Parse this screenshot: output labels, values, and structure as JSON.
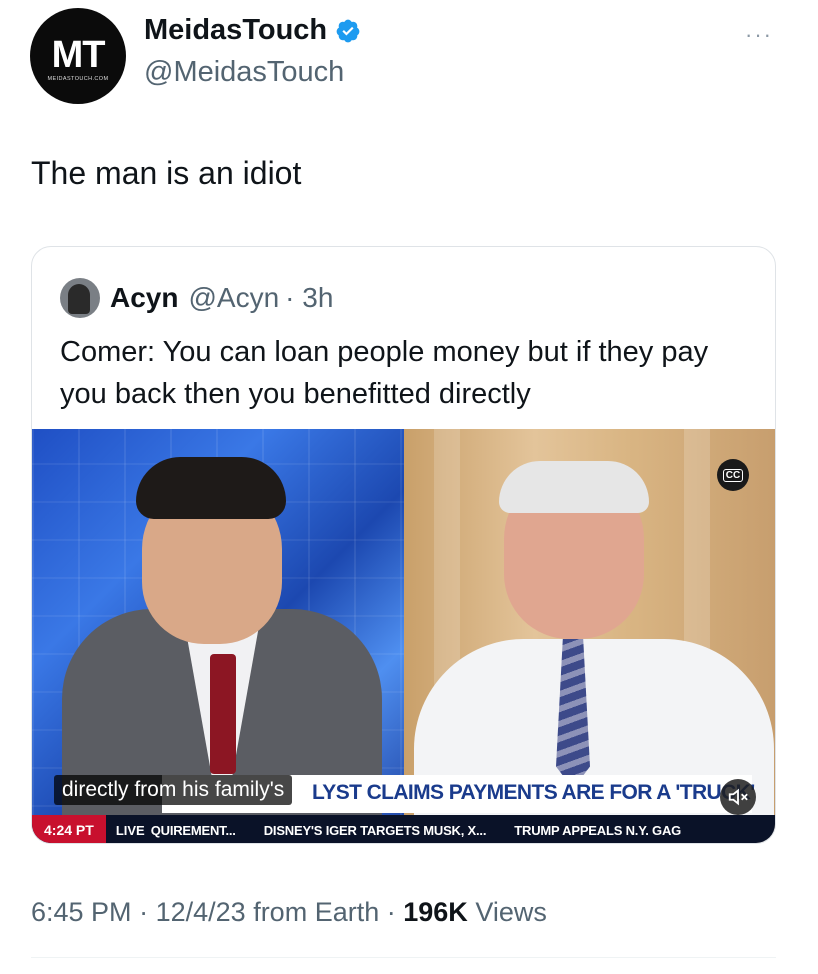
{
  "author": {
    "display_name": "MeidasTouch",
    "handle": "@MeidasTouch",
    "avatar_text": "MT",
    "avatar_site": "MEIDASTOUCH.COM",
    "verified": true
  },
  "more_label": "···",
  "tweet": {
    "text": "The man is an idiot"
  },
  "quoted": {
    "display_name": "Acyn",
    "handle": "@Acyn",
    "age": "· 3h",
    "text": "Comer: You can loan people money but if they pay you back then you benefitted directly"
  },
  "video": {
    "cc_label": "CC",
    "caption": "directly from his family's",
    "headline": "LYST CLAIMS PAYMENTS ARE FOR A 'TRUCK'",
    "ticker": {
      "time": "4:24 PT",
      "live": "LIVE",
      "items": [
        "QUIREMENT...",
        "DISNEY'S IGER TARGETS MUSK, X...",
        "TRUMP APPEALS N.Y. GAG"
      ]
    }
  },
  "meta": {
    "time": "6:45 PM",
    "date": "12/4/23",
    "source": "from Earth",
    "views_count": "196K",
    "views_label": "Views"
  },
  "colors": {
    "verified": "#1d9bf0",
    "ticker_red": "#c8102e",
    "headline_blue": "#1a3b8c"
  }
}
